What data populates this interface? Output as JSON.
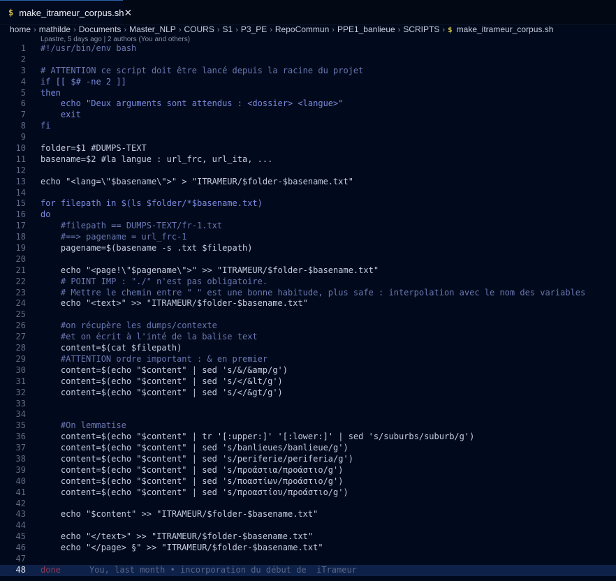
{
  "tab": {
    "icon": "$",
    "title": "make_itrameur_corpus.sh",
    "close": "✕"
  },
  "breadcrumb": [
    "home",
    "mathilde",
    "Documents",
    "Master_NLP",
    "COURS",
    "S1",
    "P3_PE",
    "RepoCommun",
    "PPE1_banlieue",
    "SCRIPTS"
  ],
  "breadcrumb_file": "make_itrameur_corpus.sh",
  "blame": "Lpastre, 5 days ago | 2 authors (You and others)",
  "lines": [
    {
      "n": "1",
      "t": "#!/usr/bin/env bash",
      "k": "com"
    },
    {
      "n": "2",
      "t": "",
      "k": ""
    },
    {
      "n": "3",
      "t": "# ATTENTION ce script doit être lancé depuis la racine du projet",
      "k": "com"
    },
    {
      "n": "4",
      "t": "if [[ $# -ne 2 ]]",
      "k": "kw"
    },
    {
      "n": "5",
      "t": "then",
      "k": "kw"
    },
    {
      "n": "6",
      "t": "    echo \"Deux arguments sont attendus : <dossier> <langue>\"",
      "k": "kw"
    },
    {
      "n": "7",
      "t": "    exit",
      "k": "kw"
    },
    {
      "n": "8",
      "t": "fi",
      "k": "kw"
    },
    {
      "n": "9",
      "t": "",
      "k": ""
    },
    {
      "n": "10",
      "t": "folder=$1 #DUMPS-TEXT",
      "k": ""
    },
    {
      "n": "11",
      "t": "basename=$2 #la langue : url_frc, url_ita, ...",
      "k": ""
    },
    {
      "n": "12",
      "t": "",
      "k": ""
    },
    {
      "n": "13",
      "t": "echo \"<lang=\\\"$basename\\\">\" > \"ITRAMEUR/$folder-$basename.txt\"",
      "k": ""
    },
    {
      "n": "14",
      "t": "",
      "k": ""
    },
    {
      "n": "15",
      "t": "for filepath in $(ls $folder/*$basename.txt)",
      "k": "kw"
    },
    {
      "n": "16",
      "t": "do",
      "k": "kw"
    },
    {
      "n": "17",
      "t": "    #filepath == DUMPS-TEXT/fr-1.txt",
      "k": "com"
    },
    {
      "n": "18",
      "t": "    #==> pagename = url_frc-1",
      "k": "com"
    },
    {
      "n": "19",
      "t": "    pagename=$(basename -s .txt $filepath)",
      "k": ""
    },
    {
      "n": "20",
      "t": "",
      "k": ""
    },
    {
      "n": "21",
      "t": "    echo \"<page!\\\"$pagename\\\">\" >> \"ITRAMEUR/$folder-$basename.txt\"",
      "k": ""
    },
    {
      "n": "22",
      "t": "    # POINT IMP : \"./\" n'est pas obligatoire.",
      "k": "com"
    },
    {
      "n": "23",
      "t": "    # Mettre le chemin entre \" \" est une bonne habitude, plus safe : interpolation avec le nom des variables",
      "k": "com"
    },
    {
      "n": "24",
      "t": "    echo \"<text>\" >> \"ITRAMEUR/$folder-$basename.txt\"",
      "k": ""
    },
    {
      "n": "25",
      "t": "",
      "k": ""
    },
    {
      "n": "26",
      "t": "    #on récupère les dumps/contexte",
      "k": "com"
    },
    {
      "n": "27",
      "t": "    #et on écrit à l'inté de la balise text",
      "k": "com"
    },
    {
      "n": "28",
      "t": "    content=$(cat $filepath)",
      "k": ""
    },
    {
      "n": "29",
      "t": "    #ATTENTION ordre important : & en premier",
      "k": "com"
    },
    {
      "n": "30",
      "t": "    content=$(echo \"$content\" | sed 's/&/&amp/g')",
      "k": ""
    },
    {
      "n": "31",
      "t": "    content=$(echo \"$content\" | sed 's/</&lt/g')",
      "k": ""
    },
    {
      "n": "32",
      "t": "    content=$(echo \"$content\" | sed 's/</&gt/g')",
      "k": ""
    },
    {
      "n": "33",
      "t": "",
      "k": ""
    },
    {
      "n": "34",
      "t": "",
      "k": ""
    },
    {
      "n": "35",
      "t": "    #On lemmatise",
      "k": "com"
    },
    {
      "n": "36",
      "t": "    content=$(echo \"$content\" | tr '[:upper:]' '[:lower:]' | sed 's/suburbs/suburb/g')",
      "k": ""
    },
    {
      "n": "37",
      "t": "    content=$(echo \"$content\" | sed 's/banlieues/banlieue/g')",
      "k": ""
    },
    {
      "n": "38",
      "t": "    content=$(echo \"$content\" | sed 's/periferie/periferia/g')",
      "k": ""
    },
    {
      "n": "39",
      "t": "    content=$(echo \"$content\" | sed 's/προάστια/προάστιο/g')",
      "k": ""
    },
    {
      "n": "40",
      "t": "    content=$(echo \"$content\" | sed 's/ποαστίων/προάστιο/g')",
      "k": ""
    },
    {
      "n": "41",
      "t": "    content=$(echo \"$content\" | sed 's/προαστίου/προάστιο/g')",
      "k": ""
    },
    {
      "n": "42",
      "t": "",
      "k": ""
    },
    {
      "n": "43",
      "t": "    echo \"$content\" >> \"ITRAMEUR/$folder-$basename.txt\"",
      "k": ""
    },
    {
      "n": "44",
      "t": "",
      "k": ""
    },
    {
      "n": "45",
      "t": "    echo \"</text>\" >> \"ITRAMEUR/$folder-$basename.txt\"",
      "k": ""
    },
    {
      "n": "46",
      "t": "    echo \"</page> §\" >> \"ITRAMEUR/$folder-$basename.txt\"",
      "k": ""
    },
    {
      "n": "47",
      "t": "",
      "k": ""
    },
    {
      "n": "48",
      "t": "done",
      "k": "done"
    }
  ],
  "ghost_blame": "You, last month • incorporation du début de  iTrameur",
  "colors": {
    "background": "#010a1c",
    "comment": "#6a77b0",
    "keyword": "#7c8be0",
    "current_line": "#0e2148"
  },
  "icons": [
    "shell-dollar-icon",
    "close-icon",
    "chevron-right-icon"
  ]
}
